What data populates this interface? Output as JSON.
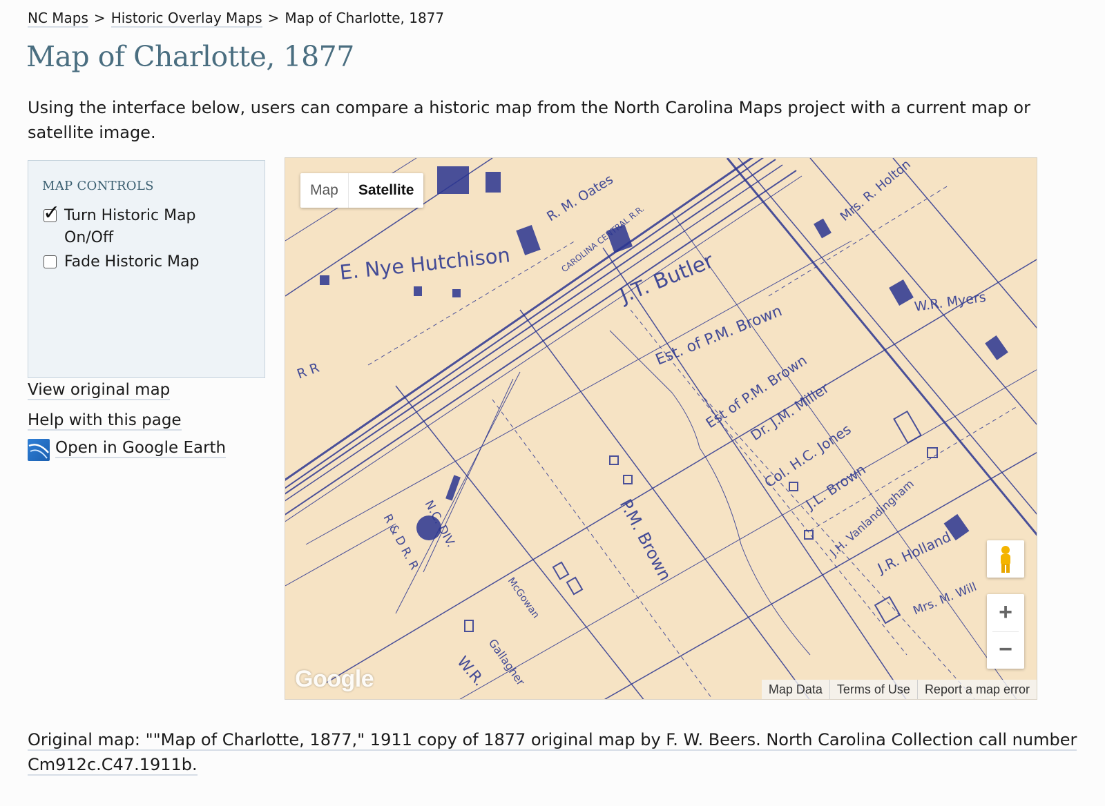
{
  "breadcrumb": {
    "items": [
      "NC Maps",
      "Historic Overlay Maps"
    ],
    "current": "Map of Charlotte, 1877",
    "separator": ">"
  },
  "page": {
    "title": "Map of Charlotte, 1877",
    "intro": "Using the interface below, users can compare a historic map from the North Carolina Maps project with a current map or satellite image."
  },
  "controls": {
    "heading": "MAP CONTROLS",
    "toggle_label": "Turn Historic Map On/Off",
    "toggle_checked": true,
    "fade_label": "Fade Historic Map",
    "fade_checked": false
  },
  "links": {
    "view_original": "View original map",
    "help": "Help with this page",
    "google_earth": "Open in Google Earth"
  },
  "map": {
    "type_map": "Map",
    "type_satellite": "Satellite",
    "selected_type": "Satellite",
    "zoom_in": "+",
    "zoom_out": "−",
    "logo": "Google",
    "attribution": [
      "Map Data",
      "Terms of Use",
      "Report a map error"
    ],
    "overlay_labels": {
      "hutchison": "E. Nye Hutchison",
      "butler": "J.T. Butler",
      "est_pm_brown": "Est. of P.M. Brown",
      "est_pm_brown2": "Est of P.M. Brown",
      "miller": "Dr. J.M. Miller",
      "jones": "Col. H.C. Jones",
      "jl_brown": "J.L. Brown",
      "vanlandingham": "J.H. Vanlandingham",
      "holland": "J.R. Holland",
      "pm_brown": "P.M. Brown",
      "myers": "W.R. Myers",
      "holton": "Mrs. R. Holton",
      "oates": "R. M. Oates",
      "mcgowan": "McGowan",
      "gallagher": "Gallagher",
      "rr": "R R",
      "ncdiv": "N.C. DIV.",
      "rdrr": "R & D R. R",
      "mrs_m_wil": "Mrs. M. Will",
      "wr": "W.R.",
      "carolina_central": "CAROLINA CENTRAL R.R."
    },
    "colors": {
      "paper": "#f6e3c4",
      "ink": "#2a3590"
    }
  },
  "footer": {
    "original_map": "Original map: \"\"Map of Charlotte, 1877,\" 1911 copy of 1877 original map by F. W. Beers. North Carolina Collection call number Cm912c.C47.1911b."
  }
}
